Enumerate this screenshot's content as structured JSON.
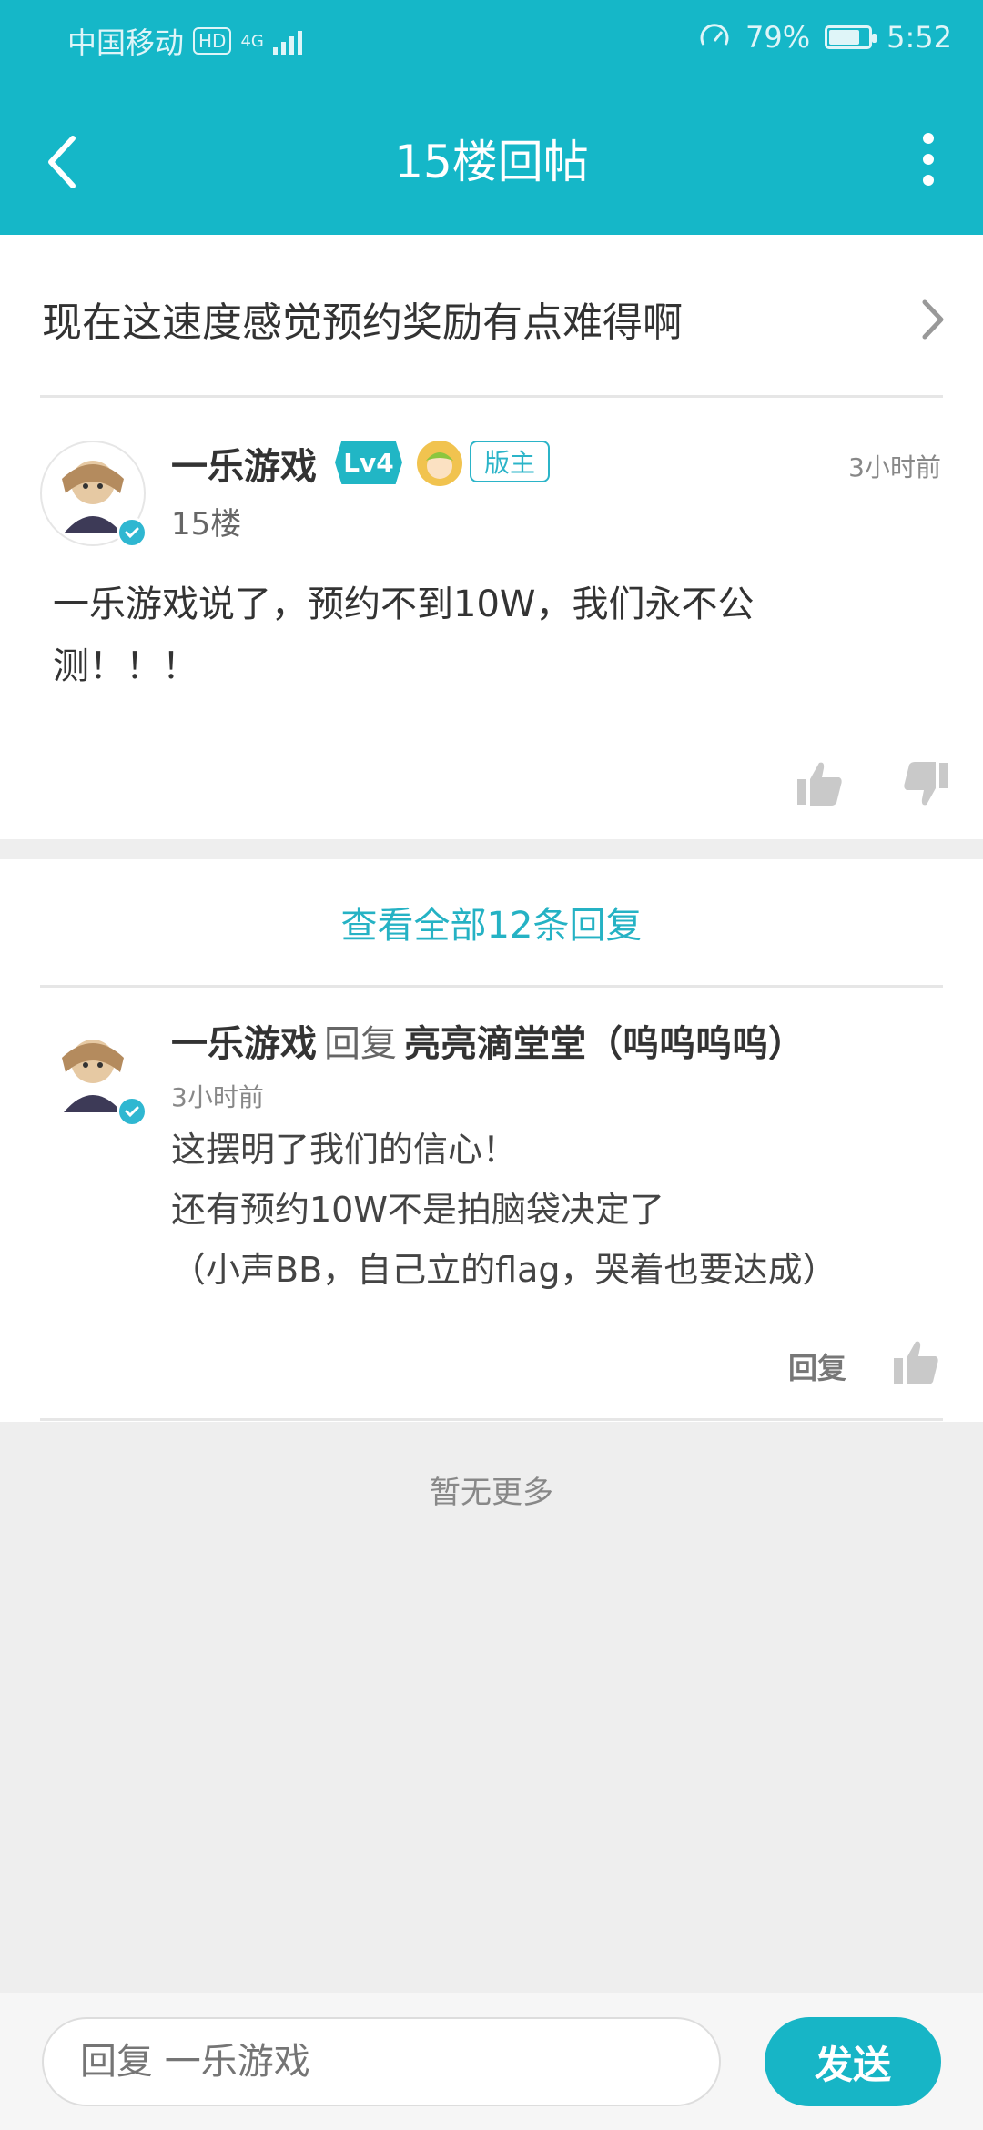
{
  "status_bar": {
    "carrier": "中国移动",
    "hd": "HD",
    "network": "4G",
    "battery_percent": "79%",
    "battery_level": 0.79,
    "time": "5:52"
  },
  "app_bar": {
    "title": "15楼回帖",
    "back_icon": "back-arrow-icon",
    "more_icon": "more-vertical-icon"
  },
  "post": {
    "topic": "现在这速度感觉预约奖励有点难得啊",
    "author": "一乐游戏",
    "level": "Lv4",
    "role_badge": "版主",
    "floor": "15楼",
    "time": "3小时前",
    "content": "一乐游戏说了，预约不到10W，我们永不公测！！！"
  },
  "replies": {
    "view_all": "查看全部12条回复",
    "items": [
      {
        "author": "一乐游戏",
        "reply_word": "回复",
        "reply_to": "亮亮滴堂堂（呜呜呜呜）",
        "time": "3小时前",
        "lines": [
          "这摆明了我们的信心！",
          "还有预约10W不是拍脑袋决定了",
          "（小声BB，自己立的flag，哭着也要达成）"
        ],
        "reply_button": "回复"
      }
    ]
  },
  "footer": {
    "no_more": "暂无更多"
  },
  "input": {
    "placeholder": "回复 一乐游戏",
    "send_label": "发送"
  },
  "colors": {
    "accent": "#15b7c8",
    "link": "#25b2c4"
  }
}
